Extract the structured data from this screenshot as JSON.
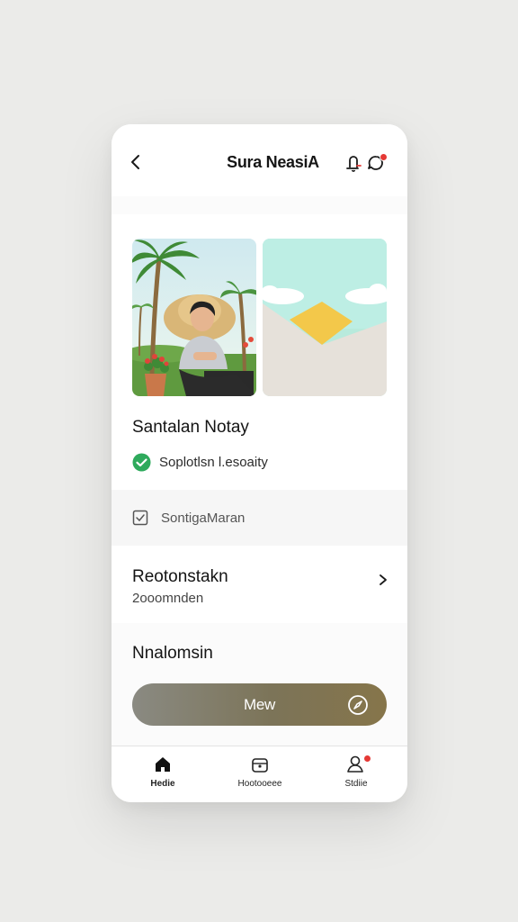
{
  "header": {
    "title": "Sura NeasiA",
    "back_icon": "chevron-left-icon",
    "bell_icon": "bell-icon",
    "chat_icon": "chat-bubble-icon",
    "badge_color": "#e53935"
  },
  "profile": {
    "name": "Santalan Notay",
    "verified_text": "Soplotlsn l.esoaity",
    "verified_color": "#2eaa5c"
  },
  "setting_row": {
    "label": "SontigaMaran",
    "icon": "checkbox-icon"
  },
  "nav_row": {
    "title": "Reotonstakn",
    "subtitle": "2ooomnden",
    "icon": "chevron-right-icon"
  },
  "section_heading": "Nnalomsin",
  "cta": {
    "label": "Mew",
    "icon": "compass-icon"
  },
  "tabbar": {
    "tabs": [
      {
        "label": "Hedie",
        "icon": "home-icon",
        "active": true
      },
      {
        "label": "Hootooeee",
        "icon": "bag-icon",
        "active": false
      },
      {
        "label": "Stdiie",
        "icon": "profile-icon",
        "active": false,
        "badge": true
      }
    ]
  }
}
